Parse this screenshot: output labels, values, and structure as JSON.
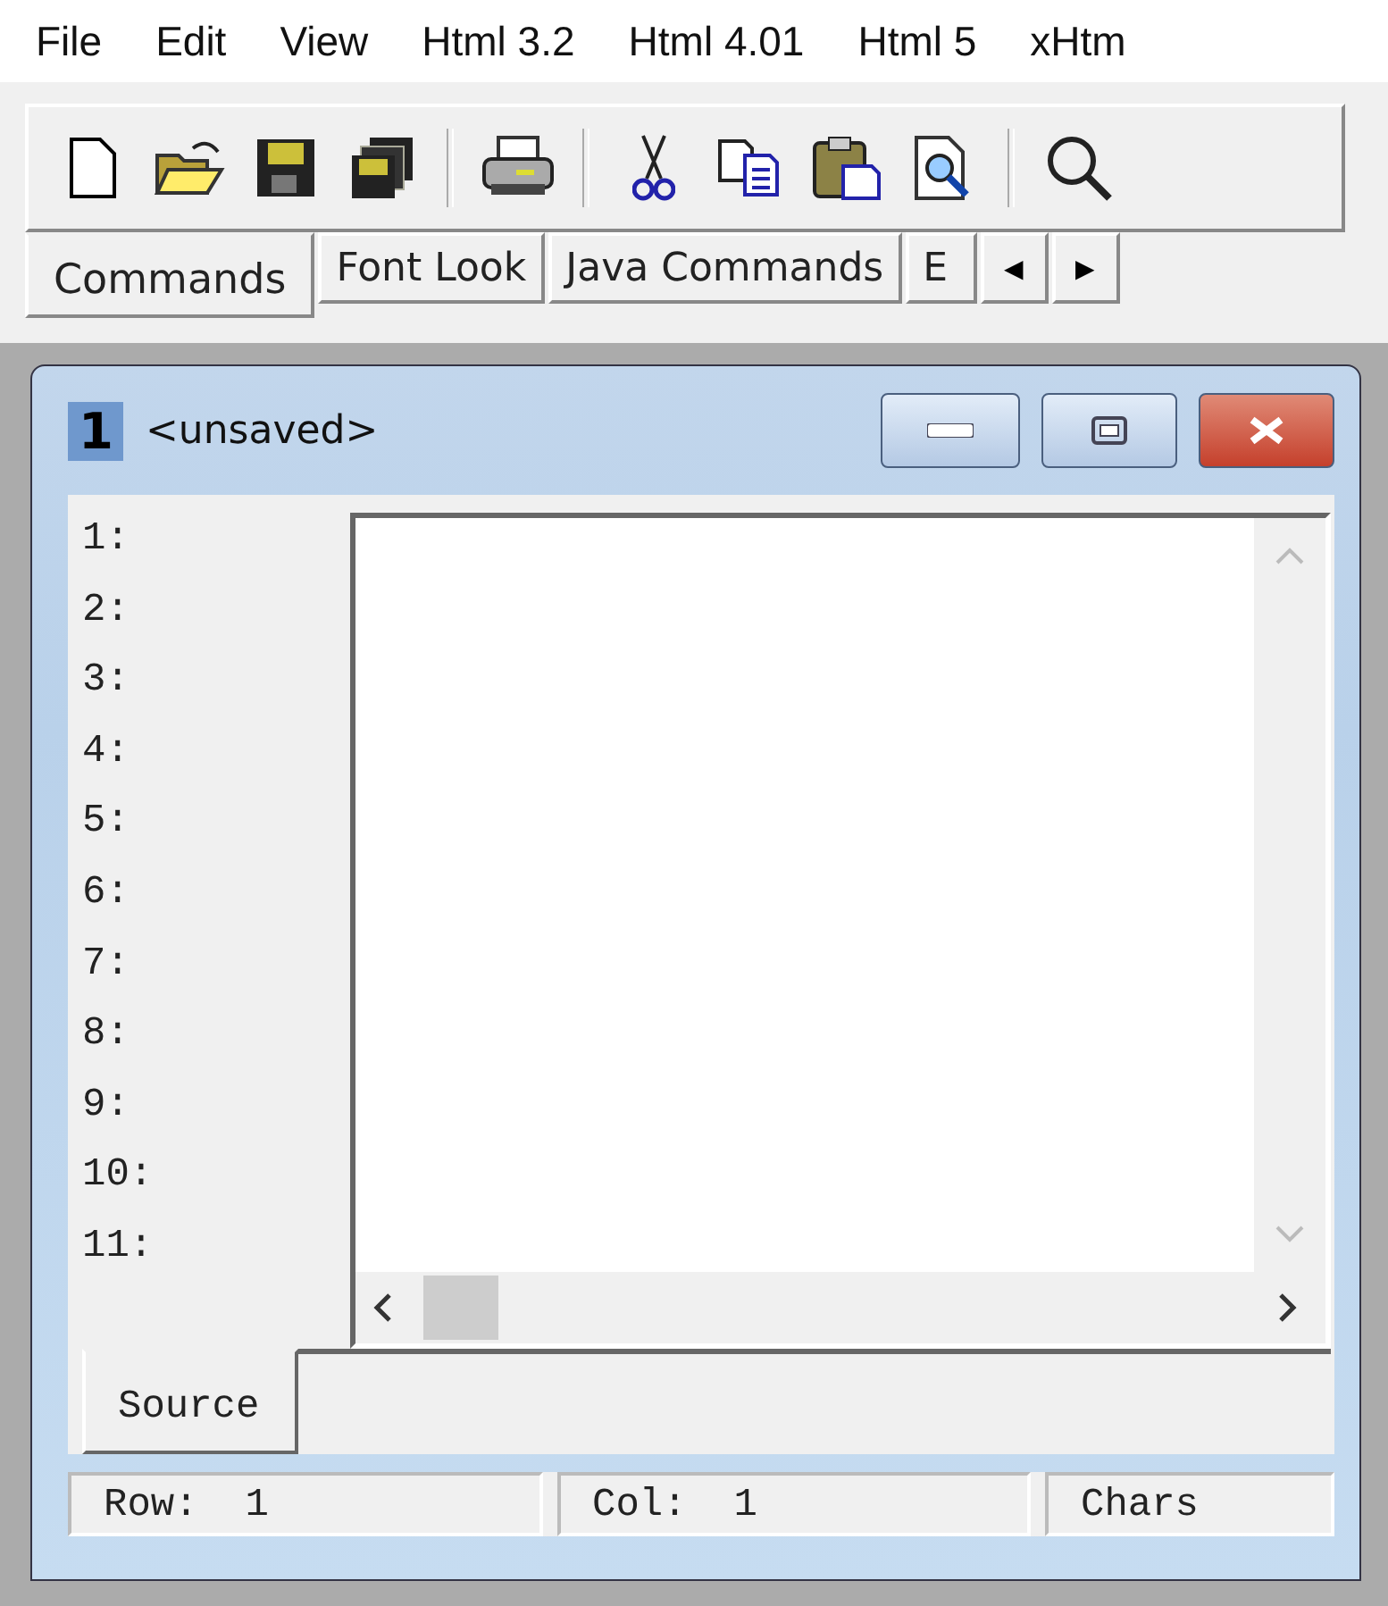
{
  "menu": [
    "File",
    "Edit",
    "View",
    "Html 3.2",
    "Html 4.01",
    "Html 5",
    "xHtm"
  ],
  "tabs": [
    {
      "label": "Commands",
      "selected": true
    },
    {
      "label": "Font Look",
      "selected": false
    },
    {
      "label": "Java Commands",
      "selected": false
    },
    {
      "label": "E",
      "selected": false
    }
  ],
  "tab_scroll": [
    "◀",
    "▶"
  ],
  "document": {
    "number": "1",
    "title": "<unsaved>",
    "line_numbers": [
      "1:",
      "2:",
      "3:",
      "4:",
      "5:",
      "6:",
      "7:",
      "8:",
      "9:",
      "10:",
      "11:"
    ],
    "view_tabs": [
      {
        "label": "Source",
        "selected": true
      }
    ]
  },
  "status_bar": [
    "Row:  1",
    "Col:  1",
    "Chars"
  ]
}
